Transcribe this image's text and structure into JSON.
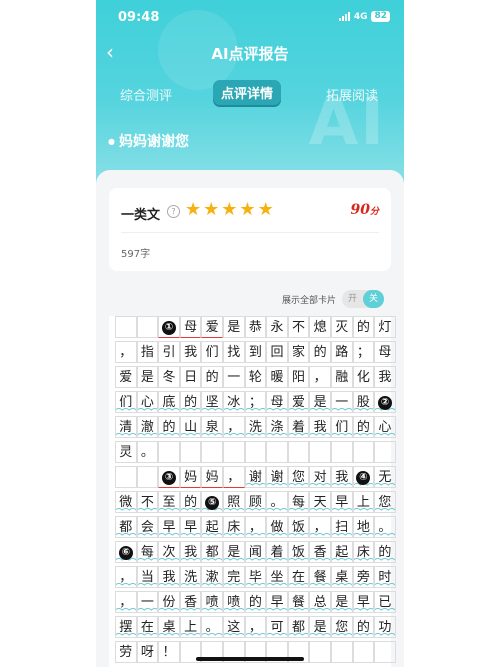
{
  "status": {
    "time": "09:48",
    "network": "4G",
    "battery": "82"
  },
  "nav": {
    "back_icon": "chevron-left-icon",
    "title": "AI点评报告"
  },
  "tabs": [
    {
      "label": "综合测评",
      "active": false
    },
    {
      "label": "点评详情",
      "active": true
    },
    {
      "label": "拓展阅读",
      "active": false
    }
  ],
  "hero_watermark": "AI",
  "essay_title": "妈妈谢谢您",
  "score_card": {
    "grade": "一类文",
    "stars": 5,
    "score": "90",
    "score_unit": "分",
    "word_count": "597字"
  },
  "toggle": {
    "label": "展示全部卡片",
    "off": "开",
    "on": "关"
  },
  "essay_rows": [
    [
      "",
      "",
      "①",
      "母",
      "爱",
      "是",
      "恭",
      "永",
      "不",
      "熄",
      "灭",
      "的",
      "灯"
    ],
    [
      "，",
      "指",
      "引",
      "我",
      "们",
      "找",
      "到",
      "回",
      "家",
      "的",
      "路",
      "；",
      "母"
    ],
    [
      "爱",
      "是",
      "冬",
      "日",
      "的",
      "一",
      "轮",
      "暖",
      "阳",
      "，",
      "融",
      "化",
      "我"
    ],
    [
      "们",
      "心",
      "底",
      "的",
      "坚",
      "冰",
      "；",
      "母",
      "爱",
      "是",
      "一",
      "股",
      "②"
    ],
    [
      "清",
      "澈",
      "的",
      "山",
      "泉",
      "，",
      "洗",
      "涤",
      "着",
      "我",
      "们",
      "的",
      "心"
    ],
    [
      "灵",
      "。",
      "",
      "",
      "",
      "",
      "",
      "",
      "",
      "",
      "",
      "",
      ""
    ],
    [
      "",
      "",
      "③",
      "妈",
      "妈",
      "，",
      "谢",
      "谢",
      "您",
      "对",
      "我",
      "④",
      "无"
    ],
    [
      "微",
      "不",
      "至",
      "的",
      "⑤",
      "照",
      "顾",
      "。",
      "每",
      "天",
      "早",
      "上",
      "您"
    ],
    [
      "都",
      "会",
      "早",
      "早",
      "起",
      "床",
      "，",
      "做",
      "饭",
      "，",
      "扫",
      "地",
      "。"
    ],
    [
      "⑥",
      "每",
      "次",
      "我",
      "都",
      "是",
      "闻",
      "着",
      "饭",
      "香",
      "起",
      "床",
      "的"
    ],
    [
      "，",
      "当",
      "我",
      "洗",
      "漱",
      "完",
      "毕",
      "坐",
      "在",
      "餐",
      "桌",
      "旁",
      "时"
    ],
    [
      "，",
      "一",
      "份",
      "香",
      "喷",
      "喷",
      "的",
      "早",
      "餐",
      "总",
      "是",
      "早",
      "已"
    ],
    [
      "摆",
      "在",
      "桌",
      "上",
      "。",
      "这",
      "，",
      "可",
      "都",
      "是",
      "您",
      "的",
      "功"
    ],
    [
      "劳",
      "呀",
      "！",
      "",
      "",
      "",
      "",
      "",
      "",
      "",
      "",
      "",
      ""
    ]
  ]
}
